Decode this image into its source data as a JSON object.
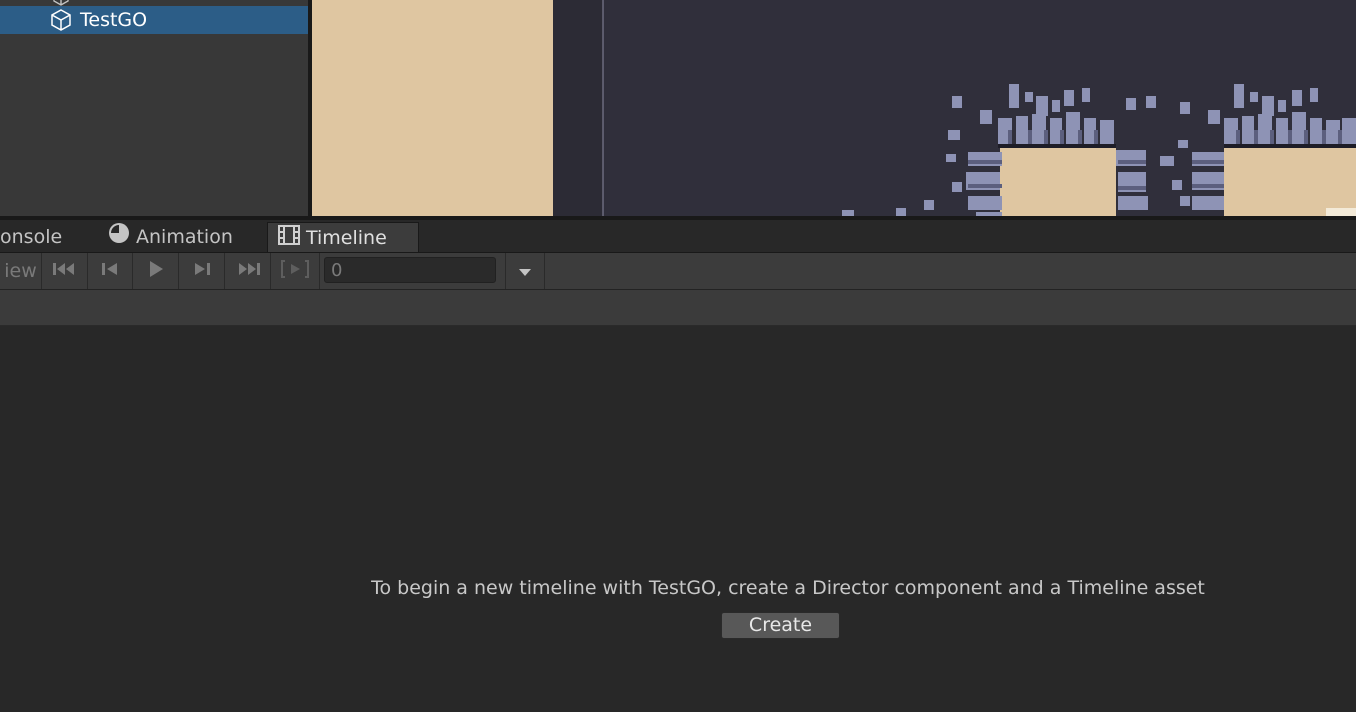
{
  "hierarchy": {
    "selected_item": "TestGO"
  },
  "tabs": [
    {
      "label": "onsole",
      "icon": "console-icon"
    },
    {
      "label": "Animation",
      "icon": "clock-icon"
    },
    {
      "label": "Timeline",
      "icon": "film-strip-icon"
    }
  ],
  "toolbar": {
    "preview_label": "iew",
    "frame_value": "0",
    "buttons": [
      "go-to-start",
      "previous-frame",
      "play",
      "next-frame",
      "go-to-end",
      "play-range",
      "dropdown"
    ]
  },
  "timeline": {
    "empty_message": "To begin a new timeline with TestGO, create a Director component and a Timeline asset",
    "create_label": "Create"
  },
  "colors": {
    "selection": "#2c5d87",
    "panel_bg": "#282828",
    "toolbar_bg": "#3c3c3c",
    "scene_bg": "#302f3b",
    "sprite_fill": "#dfc6a1"
  }
}
